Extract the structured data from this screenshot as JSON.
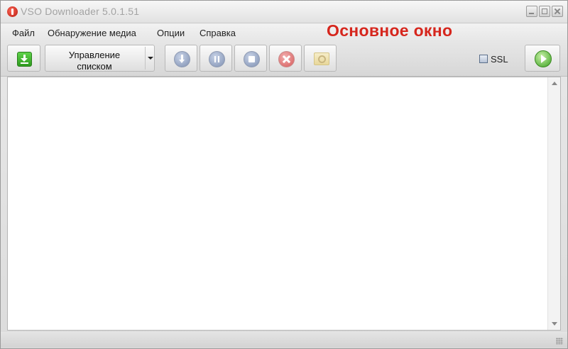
{
  "window": {
    "title": "VSO Downloader 5.0.1.51"
  },
  "menu": {
    "items": [
      "Файл",
      "Обнаружение медиа",
      "Опции",
      "Справка"
    ]
  },
  "overlay_label": "Основное окно",
  "toolbar": {
    "list_button_label_line1": "Управление",
    "list_button_label_line2": "списком",
    "ssl_label": "SSL"
  },
  "icons": {
    "app": "app-logo-icon",
    "add": "add-download-icon",
    "download": "download-icon",
    "pause": "pause-icon",
    "stop": "stop-icon",
    "cancel": "cancel-icon",
    "folder": "open-folder-icon",
    "brand": "vso-logo-icon"
  },
  "colors": {
    "overlay_label": "#d6261d",
    "accent_green": "#2e9b1e"
  }
}
